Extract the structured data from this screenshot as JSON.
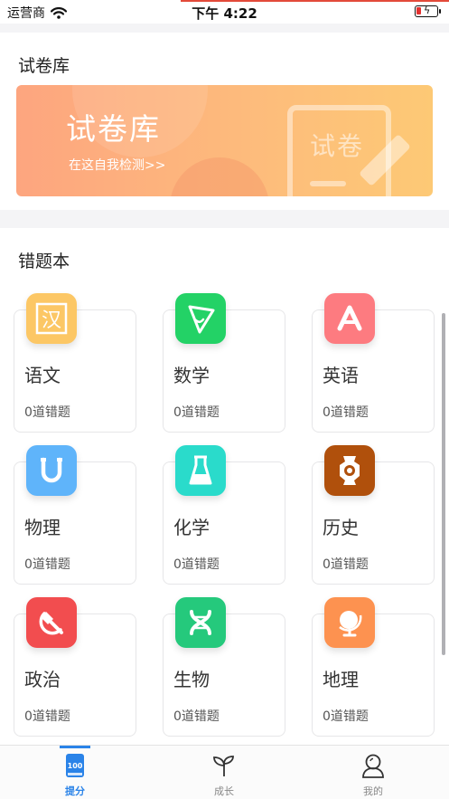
{
  "status_bar": {
    "carrier": "运营商",
    "time": "下午 4:22"
  },
  "exam_library": {
    "section_title": "试卷库",
    "banner_title": "试卷库",
    "banner_subtitle": "在这自我检测>>",
    "banner_watermark": "试卷"
  },
  "mistake_book": {
    "section_title": "错题本",
    "subjects": [
      {
        "name": "语文",
        "count_text": "0道错题",
        "icon": "chinese-char-icon",
        "color": "#fcc765"
      },
      {
        "name": "数学",
        "count_text": "0道错题",
        "icon": "math-play-icon",
        "color": "#23d266"
      },
      {
        "name": "英语",
        "count_text": "0道错题",
        "icon": "letter-a-icon",
        "color": "#fd7b80"
      },
      {
        "name": "物理",
        "count_text": "0道错题",
        "icon": "magnet-icon",
        "color": "#5fb4fa"
      },
      {
        "name": "化学",
        "count_text": "0道错题",
        "icon": "flask-icon",
        "color": "#2adbcb"
      },
      {
        "name": "历史",
        "count_text": "0道错题",
        "icon": "vase-icon",
        "color": "#b0500c"
      },
      {
        "name": "政治",
        "count_text": "0道错题",
        "icon": "hammer-sickle-icon",
        "color": "#f24d4f"
      },
      {
        "name": "生物",
        "count_text": "0道错题",
        "icon": "dna-icon",
        "color": "#25c97c"
      },
      {
        "name": "地理",
        "count_text": "0道错题",
        "icon": "globe-icon",
        "color": "#fd9250"
      }
    ]
  },
  "tab_bar": {
    "tabs": [
      {
        "label": "提分",
        "icon": "book-100-icon",
        "active": true
      },
      {
        "label": "成长",
        "icon": "sprout-icon",
        "active": false
      },
      {
        "label": "我的",
        "icon": "user-icon",
        "active": false
      }
    ],
    "active_color": "#2a83e8"
  }
}
